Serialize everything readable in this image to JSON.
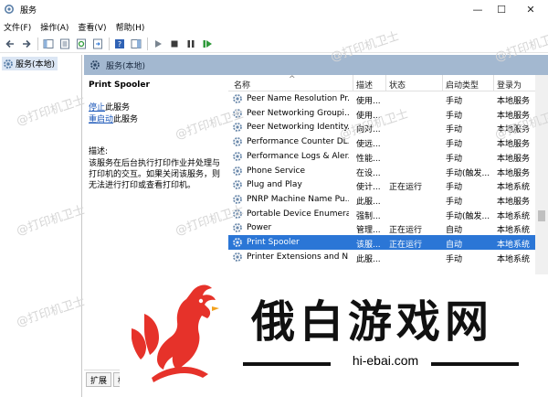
{
  "window": {
    "title": "服务",
    "minimize": "—",
    "maximize": "☐",
    "close": "✕"
  },
  "menu": [
    "文件(F)",
    "操作(A)",
    "查看(V)",
    "帮助(H)"
  ],
  "left_pane": {
    "item": "服务(本地)"
  },
  "header": {
    "title": "服务(本地)"
  },
  "desc": {
    "title": "Print Spooler",
    "stop_link": "停止",
    "stop_suffix": "此服务",
    "restart_link": "重启动",
    "restart_suffix": "此服务",
    "label": "描述:",
    "text": "该服务在后台执行打印作业并处理与打印机的交互。如果关闭该服务，则无法进行打印或查看打印机。"
  },
  "table": {
    "headers": [
      "名称",
      "描述",
      "状态",
      "启动类型",
      "登录为"
    ],
    "sort_indicator": "^",
    "rows": [
      {
        "name": "Peer Name Resolution Pr...",
        "desc": "使用...",
        "status": "",
        "startup": "手动",
        "logon": "本地服务"
      },
      {
        "name": "Peer Networking Groupi...",
        "desc": "使用...",
        "status": "",
        "startup": "手动",
        "logon": "本地服务"
      },
      {
        "name": "Peer Networking Identity...",
        "desc": "向对...",
        "status": "",
        "startup": "手动",
        "logon": "本地服务"
      },
      {
        "name": "Performance Counter DL...",
        "desc": "使远...",
        "status": "",
        "startup": "手动",
        "logon": "本地服务"
      },
      {
        "name": "Performance Logs & Aler...",
        "desc": "性能...",
        "status": "",
        "startup": "手动",
        "logon": "本地服务"
      },
      {
        "name": "Phone Service",
        "desc": "在设...",
        "status": "",
        "startup": "手动(触发...",
        "logon": "本地服务"
      },
      {
        "name": "Plug and Play",
        "desc": "使计...",
        "status": "正在运行",
        "startup": "手动",
        "logon": "本地系统"
      },
      {
        "name": "PNRP Machine Name Pu...",
        "desc": "此服...",
        "status": "",
        "startup": "手动",
        "logon": "本地服务"
      },
      {
        "name": "Portable Device Enumera...",
        "desc": "强制...",
        "status": "",
        "startup": "手动(触发...",
        "logon": "本地系统"
      },
      {
        "name": "Power",
        "desc": "管理...",
        "status": "正在运行",
        "startup": "自动",
        "logon": "本地系统"
      },
      {
        "name": "Print Spooler",
        "desc": "该服...",
        "status": "正在运行",
        "startup": "自动",
        "logon": "本地系统",
        "selected": true
      },
      {
        "name": "Printer Extensions and N...",
        "desc": "此服...",
        "status": "",
        "startup": "手动",
        "logon": "本地系统"
      }
    ]
  },
  "bottom_tabs": [
    "扩展",
    "标"
  ],
  "watermark": "@打印机卫士",
  "brand": {
    "text": "俄白游戏网",
    "url": "hi-ebai.com"
  },
  "colors": {
    "selection": "#2b76d6",
    "header_band": "#a3b8d0",
    "link": "#1a56b8",
    "logo_red": "#e6322a"
  }
}
